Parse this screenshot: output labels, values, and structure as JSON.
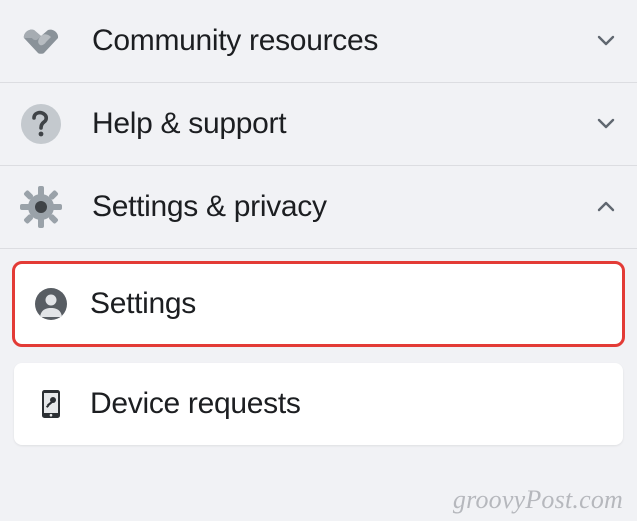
{
  "menu": {
    "items": [
      {
        "id": "community-resources",
        "label": "Community resources",
        "expanded": false
      },
      {
        "id": "help-support",
        "label": "Help & support",
        "expanded": false
      },
      {
        "id": "settings-privacy",
        "label": "Settings & privacy",
        "expanded": true
      }
    ]
  },
  "submenu": {
    "items": [
      {
        "id": "settings",
        "label": "Settings",
        "highlighted": true
      },
      {
        "id": "device-requests",
        "label": "Device requests",
        "highlighted": false
      }
    ]
  },
  "watermark": "groovyPost.com"
}
